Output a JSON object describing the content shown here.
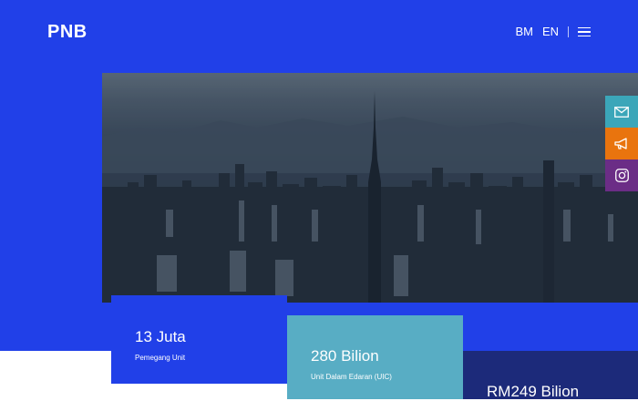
{
  "header": {
    "logo": "PNB",
    "languages": [
      "BM",
      "EN"
    ]
  },
  "side_icons": [
    "mail-icon",
    "megaphone-icon",
    "instagram-icon"
  ],
  "stats": [
    {
      "value": "13 Juta",
      "label": "Pemegang Unit"
    },
    {
      "value": "280 Bilion",
      "label": "Unit Dalam Edaran (UIC)"
    },
    {
      "value": "RM249 Bilion",
      "label": ""
    }
  ],
  "colors": {
    "brand_blue": "#2140e8",
    "teal": "#58adc4",
    "navy": "#1c2a7a",
    "mail_bg": "#3ba6b9",
    "megaphone_bg": "#e9740e",
    "instagram_bg": "#6b2d86"
  }
}
